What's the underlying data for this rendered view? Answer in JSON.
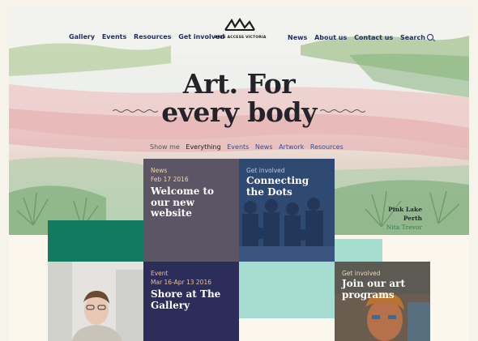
{
  "nav": {
    "left": [
      "Gallery",
      "Events",
      "Resources",
      "Get involved"
    ],
    "right": [
      "News",
      "About us",
      "Contact us",
      "Search"
    ]
  },
  "logo": {
    "text": "ARTS ACCESS VICTORIA"
  },
  "hero": {
    "headline_line1": "Art. For",
    "headline_line2": "every body",
    "caption_title": "Pink Lake Perth",
    "caption_artist": "Nita Trevor"
  },
  "filters": {
    "label": "Show me",
    "items": [
      "Everything",
      "Events",
      "News",
      "Artwork",
      "Resources"
    ],
    "active": "Everything"
  },
  "tiles": [
    {
      "category": "News",
      "date": "Feb 17 2016",
      "title": "Welcome to our new website"
    },
    {
      "category": "Get involved",
      "date": "",
      "title": "Connecting the Dots"
    },
    {
      "category": "Event",
      "date": "Mar 16-Apr 13 2016",
      "title": "Shore at The Gallery"
    },
    {
      "category": "Get involved",
      "date": "",
      "title": "Join our art programs"
    }
  ],
  "colors": {
    "nav_text": "#1d2f5f",
    "news_tile": "#5b5565",
    "dots_tile": "#2c4468",
    "event_tile": "#2d2d5a",
    "join_tile": "#5a5048",
    "green_block": "#117a60",
    "mint_block": "#a7ddd0"
  }
}
